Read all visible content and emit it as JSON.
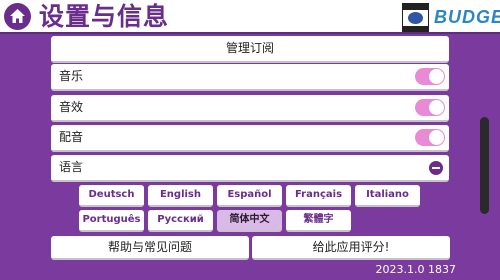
{
  "header": {
    "title": "设置与信息",
    "brand": "BUDGE",
    "home_icon": "home-icon",
    "rating_icon": "esrb-rating-icon"
  },
  "settings": {
    "manage_subscription": "管理订阅",
    "music": {
      "label": "音乐",
      "enabled": true
    },
    "sound_effects": {
      "label": "音效",
      "enabled": true
    },
    "voice": {
      "label": "配音",
      "enabled": true
    },
    "language": {
      "label": "语言",
      "expanded": true
    }
  },
  "languages": {
    "options": [
      "Deutsch",
      "English",
      "Español",
      "Français",
      "Italiano",
      "Português",
      "Русский",
      "简体中文",
      "繁體字"
    ],
    "selected": "简体中文"
  },
  "actions": {
    "help": "帮助与常见问题",
    "rate": "给此应用评分!"
  },
  "version": "2023.1.0 1837",
  "colors": {
    "background": "#7b3a9e",
    "accent": "#6a2d8c",
    "toggle_on": "#e88ad6",
    "brand": "#2a86c9"
  }
}
